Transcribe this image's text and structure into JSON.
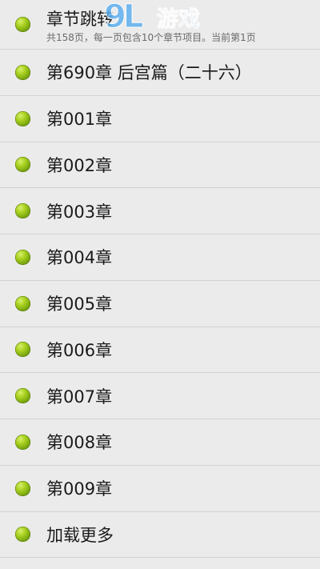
{
  "header": {
    "title": "章节跳转",
    "subtitle": "共158页，每一页包含10个章节项目。当前第1页"
  },
  "watermark": {
    "mark": "9L",
    "text": "游戏"
  },
  "chapters": [
    {
      "label": "第690章 后宫篇（二十六）"
    },
    {
      "label": "第001章"
    },
    {
      "label": "第002章"
    },
    {
      "label": "第003章"
    },
    {
      "label": "第004章"
    },
    {
      "label": "第005章"
    },
    {
      "label": "第006章"
    },
    {
      "label": "第007章"
    },
    {
      "label": "第008章"
    },
    {
      "label": "第009章"
    }
  ],
  "load_more": {
    "label": "加载更多"
  },
  "colors": {
    "background": "#ebebeb",
    "divider": "#d2d2d2",
    "bullet": "#8cbf1a",
    "text": "#1a1a1a",
    "watermark": "#5fb0ef"
  },
  "icons": {
    "bullet": "green-dot-icon"
  }
}
